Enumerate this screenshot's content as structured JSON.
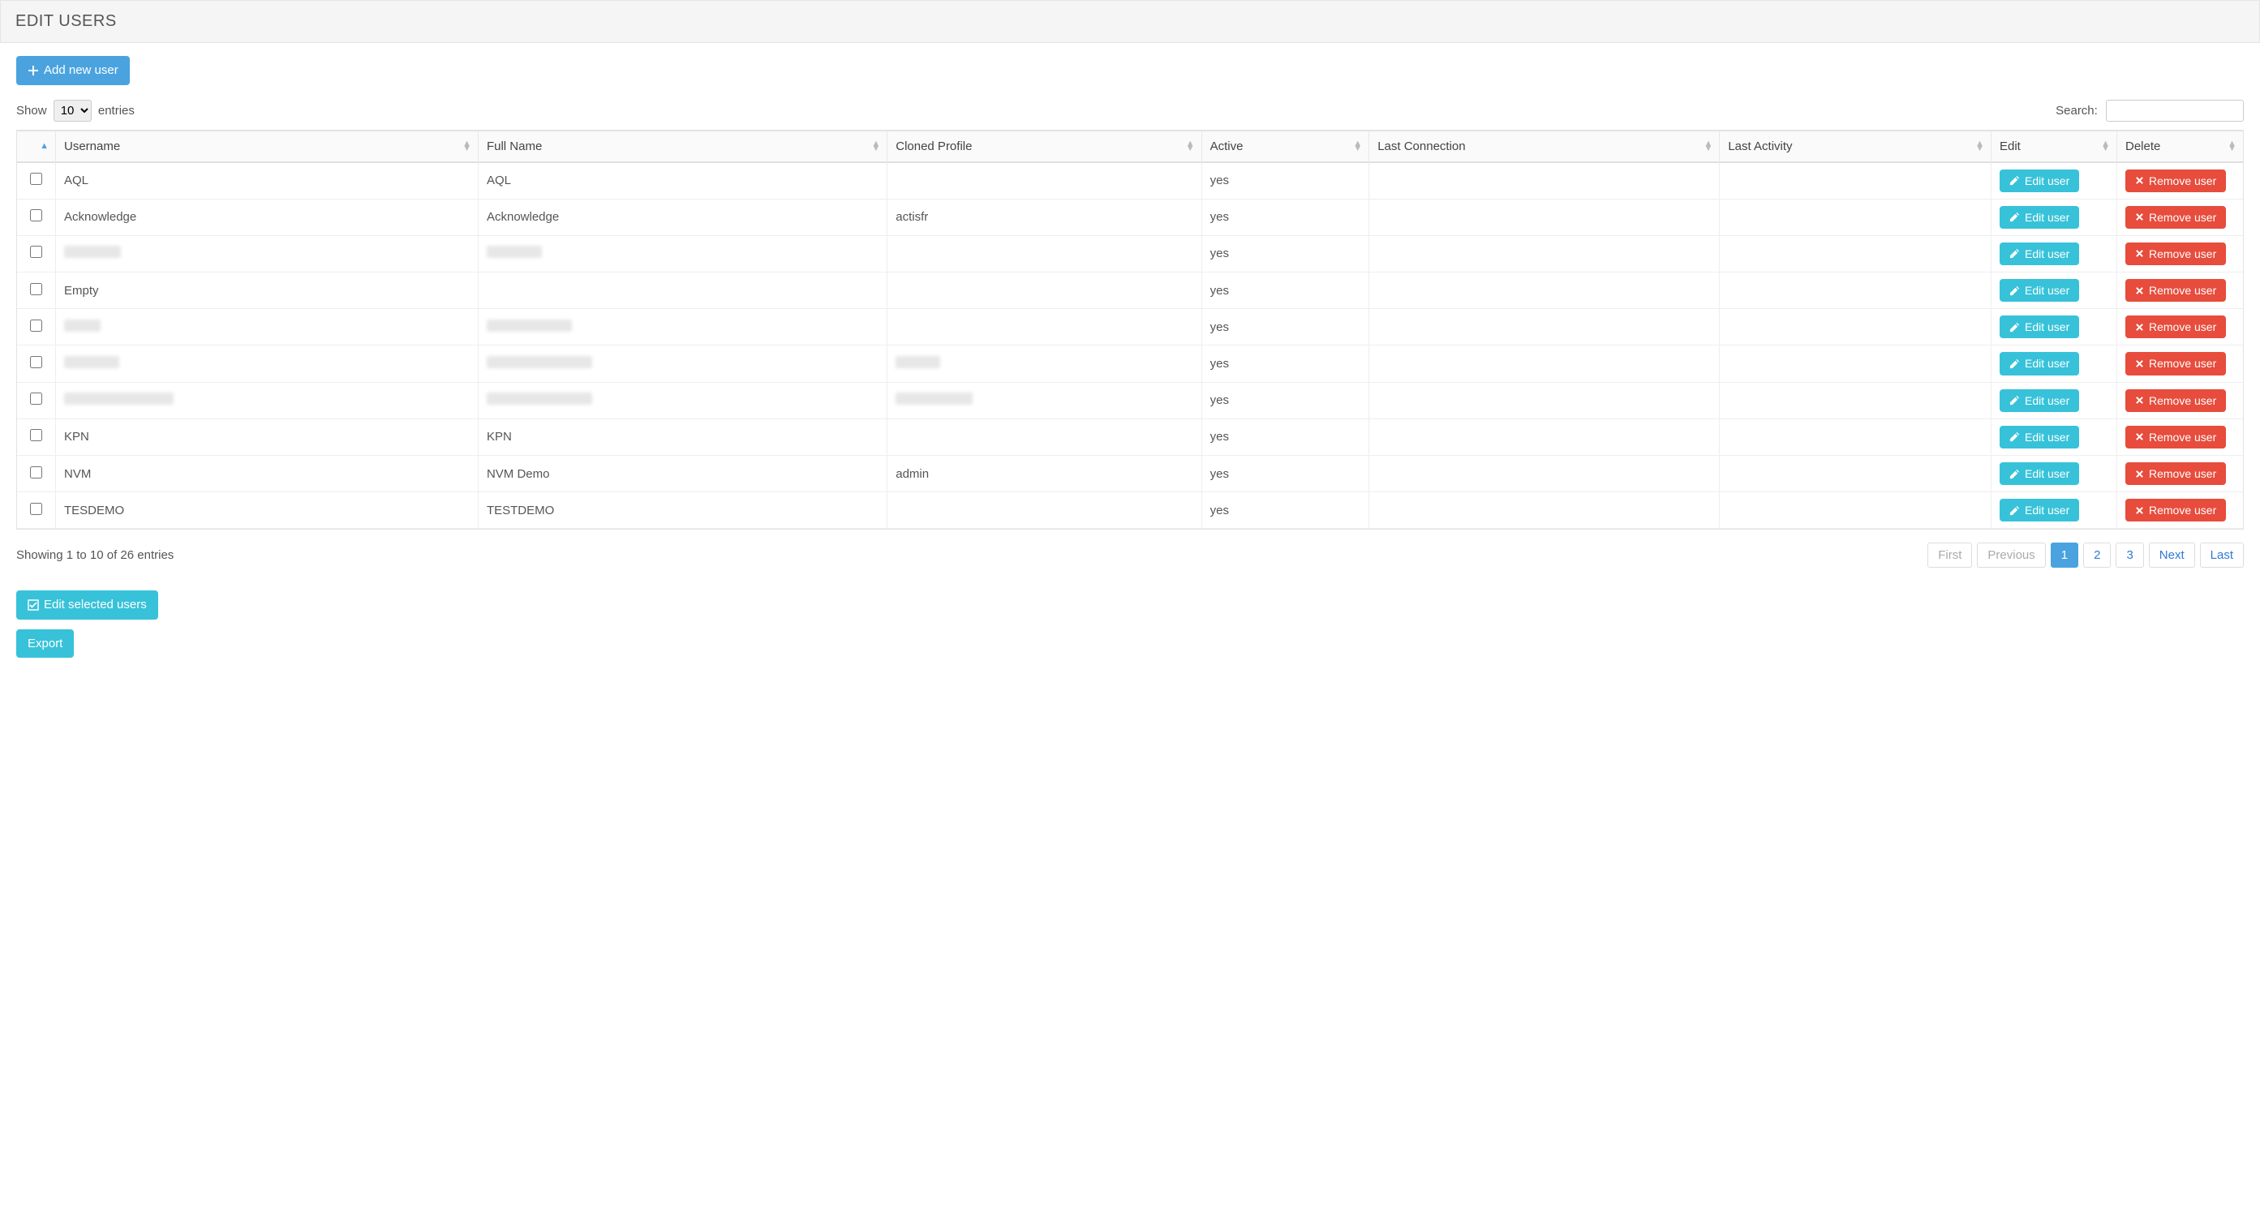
{
  "header": {
    "title": "EDIT USERS"
  },
  "actions": {
    "add_user_label": "Add new user",
    "edit_selected_label": "Edit selected users",
    "export_label": "Export"
  },
  "length_menu": {
    "show_label": "Show",
    "entries_label": "entries",
    "selected": "10"
  },
  "search": {
    "label": "Search:",
    "value": ""
  },
  "columns": {
    "checkbox": "",
    "username": "Username",
    "fullname": "Full Name",
    "cloned": "Cloned Profile",
    "active": "Active",
    "last_connection": "Last Connection",
    "last_activity": "Last Activity",
    "edit": "Edit",
    "delete": "Delete"
  },
  "row_buttons": {
    "edit_label": "Edit user",
    "remove_label": "Remove user"
  },
  "rows": [
    {
      "username": "AQL",
      "fullname": "AQL",
      "cloned": "",
      "active": "yes",
      "last_connection": "",
      "last_activity": "",
      "redacted": false
    },
    {
      "username": "Acknowledge",
      "fullname": "Acknowledge",
      "cloned": "actisfr",
      "active": "yes",
      "last_connection": "",
      "last_activity": "",
      "redacted": false
    },
    {
      "username": "",
      "fullname": "",
      "cloned": "",
      "active": "yes",
      "last_connection": "",
      "last_activity": "",
      "redacted": true,
      "redact_widths": {
        "username": 70,
        "fullname": 68,
        "cloned": 0
      }
    },
    {
      "username": "Empty",
      "fullname": "",
      "cloned": "",
      "active": "yes",
      "last_connection": "",
      "last_activity": "",
      "redacted": false
    },
    {
      "username": "",
      "fullname": "",
      "cloned": "",
      "active": "yes",
      "last_connection": "",
      "last_activity": "",
      "redacted": true,
      "redact_widths": {
        "username": 45,
        "fullname": 105,
        "cloned": 0
      }
    },
    {
      "username": "",
      "fullname": "",
      "cloned": "",
      "active": "yes",
      "last_connection": "",
      "last_activity": "",
      "redacted": true,
      "redact_widths": {
        "username": 68,
        "fullname": 130,
        "cloned": 55
      }
    },
    {
      "username": "",
      "fullname": "",
      "cloned": "",
      "active": "yes",
      "last_connection": "",
      "last_activity": "",
      "redacted": true,
      "redact_widths": {
        "username": 135,
        "fullname": 130,
        "cloned": 95
      }
    },
    {
      "username": "KPN",
      "fullname": "KPN",
      "cloned": "",
      "active": "yes",
      "last_connection": "",
      "last_activity": "",
      "redacted": false
    },
    {
      "username": "NVM",
      "fullname": "NVM Demo",
      "cloned": "admin",
      "active": "yes",
      "last_connection": "",
      "last_activity": "",
      "redacted": false
    },
    {
      "username": "TESDEMO",
      "fullname": "TESTDEMO",
      "cloned": "",
      "active": "yes",
      "last_connection": "",
      "last_activity": "",
      "redacted": false
    }
  ],
  "info_text": "Showing 1 to 10 of 26 entries",
  "pagination": {
    "first": "First",
    "previous": "Previous",
    "pages": [
      "1",
      "2",
      "3"
    ],
    "active_page": "1",
    "next": "Next",
    "last": "Last"
  }
}
